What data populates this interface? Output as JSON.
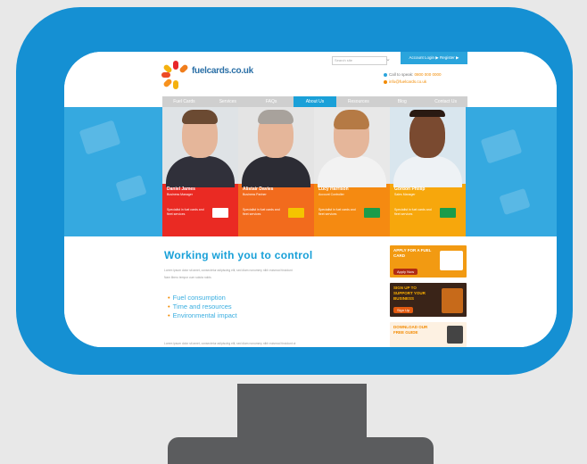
{
  "site": {
    "logo_text": "fuelcards.co.uk",
    "search_placeholder": "Search site",
    "login_label": "Account Login ▶  Register ▶",
    "contact_phone_label": "Call to speak:",
    "contact_phone": "0800 000 0000",
    "contact_email": "info@fuelcards.co.uk"
  },
  "nav": {
    "items": [
      {
        "label": "Fuel Cards",
        "active": false
      },
      {
        "label": "Services",
        "active": false
      },
      {
        "label": "FAQs",
        "active": false
      },
      {
        "label": "About Us",
        "active": true
      },
      {
        "label": "Resources",
        "active": false
      },
      {
        "label": "Blog",
        "active": false
      },
      {
        "label": "Contact Us",
        "active": false
      }
    ]
  },
  "team": [
    {
      "name": "Daniel James",
      "role": "Business Manager",
      "blurb": "Specialist in fuel cards and fleet services",
      "bg": "#ea2a23",
      "badge": "#ffffff"
    },
    {
      "name": "Alistair Davies",
      "role": "Business Partner",
      "blurb": "Specialist in fuel cards and fleet services",
      "bg": "#f26b1d",
      "badge": "#f4c400"
    },
    {
      "name": "Lucy Harrison",
      "role": "Account Controller",
      "blurb": "Specialist in fuel cards and fleet services",
      "bg": "#f58a11",
      "badge": "#1b9c4a"
    },
    {
      "name": "Gordon Phillip",
      "role": "Sales Manager",
      "blurb": "Specialist in fuel cards and fleet services",
      "bg": "#f7a70c",
      "badge": "#1b9c4a"
    }
  ],
  "content": {
    "headline": "Working with you to control",
    "intro": "Lorem ipsum dolor sit amet, consectetur adipiscing elit, sed diam nonummy nibh euismod tincidunt",
    "intro2": "Nam libero tempor cum soluta nobis",
    "bullets": [
      "Fuel consumption",
      "Time and resources",
      "Environmental impact"
    ],
    "outro": "Lorem ipsum dolor sit amet, consectetur adipiscing elit, sed diam nonummy nibh euismod tincidunt ut"
  },
  "ads": [
    {
      "title": "APPLY FOR A FUEL CARD",
      "button": "Apply Now",
      "bg": "#f29a12"
    },
    {
      "title": "SIGN UP TO SUPPORT YOUR BUSINESS",
      "button": "Sign Up",
      "bg": "#3a2418"
    },
    {
      "title": "DOWNLOAD OUR FREE GUIDE",
      "button": "",
      "bg": "#fdf1e2"
    }
  ]
}
